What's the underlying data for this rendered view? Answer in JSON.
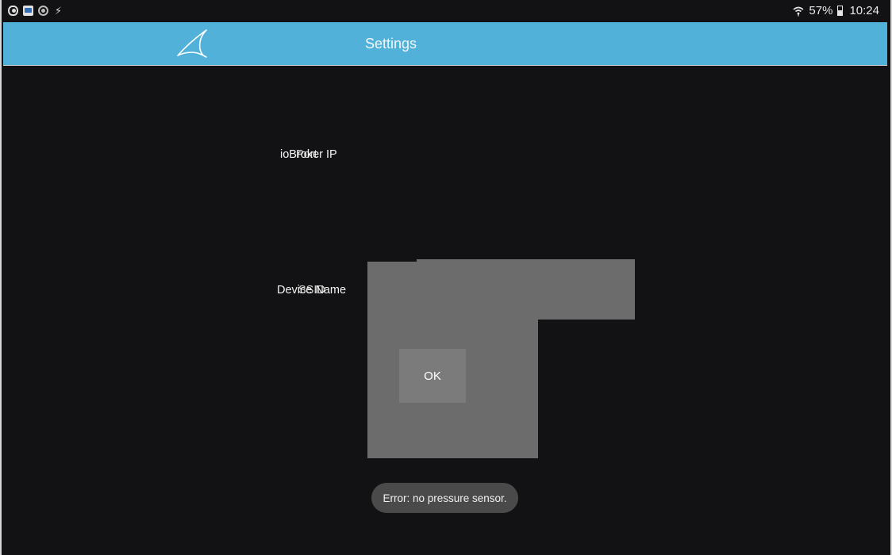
{
  "status_bar": {
    "left_icons": [
      "eye-icon",
      "photo-icon",
      "target-icon",
      "bolt-icon"
    ],
    "battery": "57%",
    "time": "10:24"
  },
  "action_bar": {
    "title": "Settings",
    "color": "#52b1d8"
  },
  "form": {
    "label_ip_a": "ioBroker IP",
    "label_ip_b": "Port",
    "label_device_a": "Device Name",
    "label_device_b": "SSID"
  },
  "dialog": {
    "ok_label": "OK",
    "panel_color": "#6c6c6c"
  },
  "toast": {
    "message": "Error: no pressure sensor."
  },
  "theme": {
    "background": "#121113"
  }
}
